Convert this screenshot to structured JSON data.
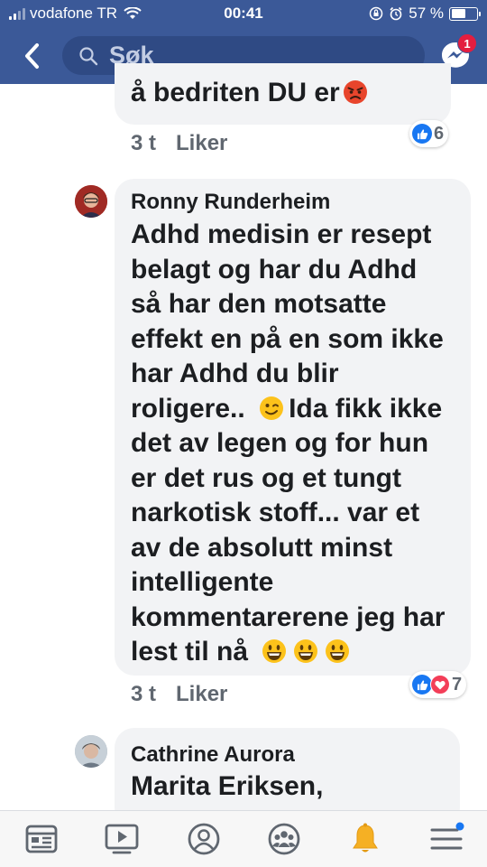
{
  "status_bar": {
    "carrier": "vodafone TR",
    "time": "00:41",
    "battery": "57 %"
  },
  "header": {
    "search_placeholder": "Søk",
    "messenger_badge": "1"
  },
  "comments": [
    {
      "text_tail": "å bedriten DU er",
      "time": "3 t",
      "like_label": "Liker",
      "reaction_count": "6"
    },
    {
      "author": "Ronny Runderheim",
      "lines": [
        "Adhd medisin er resept",
        "belagt og har du Adhd",
        "så har den motsatte",
        "effekt en på en som ikke",
        "har Adhd du blir",
        "roligere..",
        "Ida fikk ikke",
        "det av legen og for hun",
        "er det rus og et tungt",
        "narkotisk stoff... var et",
        "av de absolutt minst",
        "intelligente",
        "kommentarerene jeg har",
        "lest til nå"
      ],
      "time": "3 t",
      "like_label": "Liker",
      "reaction_count": "7"
    },
    {
      "author": "Cathrine Aurora",
      "text": "Marita Eriksen,"
    }
  ],
  "colors": {
    "brand": "#3b5998",
    "bubble": "#f2f3f5",
    "like": "#1877f2",
    "love": "#f33e58"
  },
  "nav": [
    "news-feed",
    "watch",
    "profile",
    "groups",
    "notifications",
    "menu"
  ]
}
